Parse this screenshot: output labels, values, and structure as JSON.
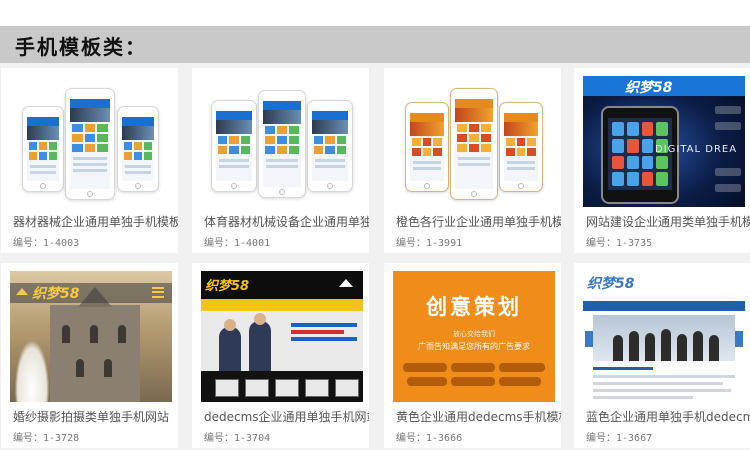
{
  "section": {
    "title": "手机模板类："
  },
  "cards": [
    {
      "title": "器材器械企业通用单独手机模板",
      "id_label": "编号：",
      "id_value": "1-4003"
    },
    {
      "title": "体育器材机械设备企业通用单独",
      "id_label": "编号：",
      "id_value": "1-4001"
    },
    {
      "title": "橙色各行业企业通用单独手机模",
      "id_label": "编号：",
      "id_value": "1-3991"
    },
    {
      "title": "网站建设企业通用类单独手机模",
      "id_label": "编号：",
      "id_value": "1-3735"
    },
    {
      "title": "婚纱摄影拍摄类单独手机网站",
      "id_label": "编号：",
      "id_value": "1-3728"
    },
    {
      "title": "dedecms企业通用单独手机网站模",
      "id_label": "编号：",
      "id_value": "1-3704"
    },
    {
      "title": "黄色企业通用dedecms手机模板",
      "id_label": "编号：",
      "id_value": "1-3666"
    },
    {
      "title": "蓝色企业通用单独手机dedecms模",
      "id_label": "编号：",
      "id_value": "1-3667"
    }
  ],
  "thumbs": {
    "card4_logo": "织梦58",
    "card4_banner": "DIGITAL DREA",
    "card5_logo": "织梦58",
    "card6_logo": "织梦58",
    "card7_headline": "创意策划",
    "card7_sub1": "放心交给我们",
    "card7_sub2": "广而告知满足您所有的广告要求",
    "card8_logo": "织梦58"
  },
  "colors": {
    "section_bar": "#c9c9c9",
    "grid_bg": "#f1f1f1",
    "card7_orange": "#f08c1a",
    "brand_blue": "#1a74d6"
  }
}
